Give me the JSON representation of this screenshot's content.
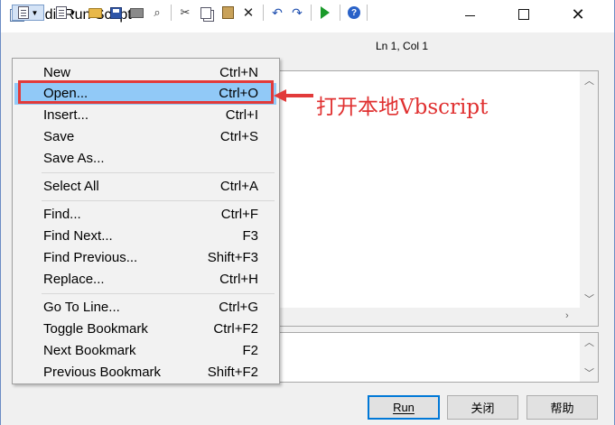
{
  "window": {
    "title": "Edit/Run Script",
    "minimize_glyph": "",
    "close_glyph": "✕"
  },
  "toolbar": {
    "position_readout": "Ln 1, Col 1",
    "icons": [
      "file-menu-icon",
      "new-file-icon",
      "open-folder-icon",
      "save-icon",
      "print-icon",
      "find-icon",
      "cut-icon",
      "copy-icon",
      "paste-icon",
      "delete-icon",
      "undo-icon",
      "redo-icon",
      "run-icon",
      "help-icon"
    ]
  },
  "menu": {
    "groups": [
      [
        {
          "label": "New",
          "shortcut": "Ctrl+N"
        },
        {
          "label": "Open...",
          "shortcut": "Ctrl+O"
        },
        {
          "label": "Insert...",
          "shortcut": "Ctrl+I"
        },
        {
          "label": "Save",
          "shortcut": "Ctrl+S"
        },
        {
          "label": "Save As...",
          "shortcut": ""
        }
      ],
      [
        {
          "label": "Select All",
          "shortcut": "Ctrl+A"
        }
      ],
      [
        {
          "label": "Find...",
          "shortcut": "Ctrl+F"
        },
        {
          "label": "Find Next...",
          "shortcut": "F3"
        },
        {
          "label": "Find Previous...",
          "shortcut": "Shift+F3"
        },
        {
          "label": "Replace...",
          "shortcut": "Ctrl+H"
        }
      ],
      [
        {
          "label": "Go To Line...",
          "shortcut": "Ctrl+G"
        },
        {
          "label": "Toggle Bookmark",
          "shortcut": "Ctrl+F2"
        },
        {
          "label": "Next Bookmark",
          "shortcut": "F2"
        },
        {
          "label": "Previous Bookmark",
          "shortcut": "Shift+F2"
        }
      ]
    ],
    "highlighted": "Open..."
  },
  "buttons": {
    "run": "Run",
    "close": "关闭",
    "help": "帮助"
  },
  "annotation": {
    "text": "打开本地Vbscript",
    "color": "#e03030"
  },
  "colors": {
    "menu_highlight": "#91c9f7",
    "annotation_red": "#e23a3a",
    "default_button_border": "#0078d7"
  }
}
